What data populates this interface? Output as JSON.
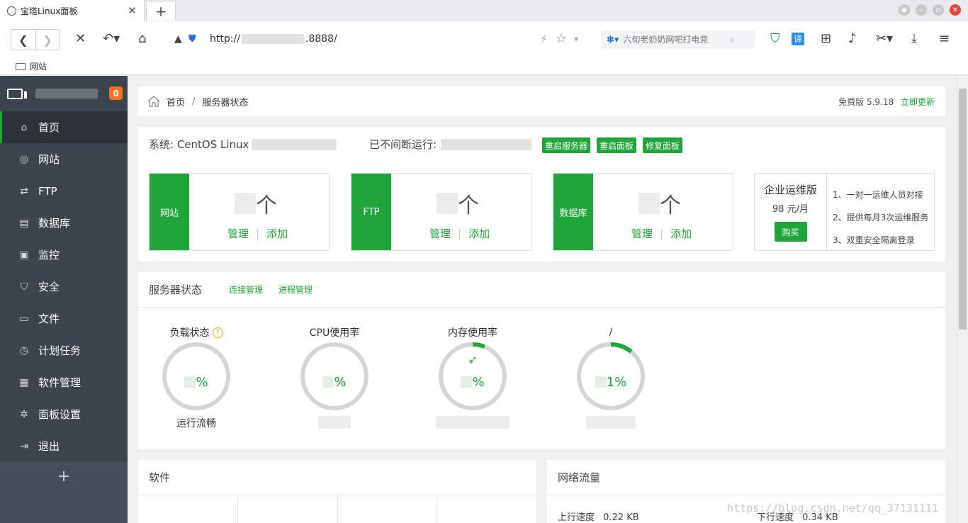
{
  "browser": {
    "tab_title": "宝塔Linux面板",
    "tab_close": "✕",
    "new_tab": "+",
    "url_prefix": "http://",
    "url_suffix": ".8888/",
    "search_placeholder": "六旬老奶奶网吧打电竞",
    "translate_label": "译",
    "bookmark_folder": "网站"
  },
  "sidebar": {
    "badge": "0",
    "items": [
      {
        "label": "首页",
        "icon": "home-icon",
        "glyph": "⌂"
      },
      {
        "label": "网站",
        "icon": "globe-icon",
        "glyph": "◎"
      },
      {
        "label": "FTP",
        "icon": "ftp-icon",
        "glyph": "⇄"
      },
      {
        "label": "数据库",
        "icon": "database-icon",
        "glyph": "▤"
      },
      {
        "label": "监控",
        "icon": "monitor-chart-icon",
        "glyph": "▣"
      },
      {
        "label": "安全",
        "icon": "shield-icon",
        "glyph": "⛉"
      },
      {
        "label": "文件",
        "icon": "folder-icon",
        "glyph": "▭"
      },
      {
        "label": "计划任务",
        "icon": "clock-icon",
        "glyph": "◷"
      },
      {
        "label": "软件管理",
        "icon": "grid-icon",
        "glyph": "▦"
      },
      {
        "label": "面板设置",
        "icon": "gear-icon",
        "glyph": "✲"
      },
      {
        "label": "退出",
        "icon": "logout-icon",
        "glyph": "⇥"
      }
    ],
    "add_label": "+"
  },
  "breadcrumb": {
    "home": "首页",
    "separator": "/",
    "current": "服务器状态",
    "version": "免费版 5.9.18",
    "update": "立即更新"
  },
  "system": {
    "os_label": "系统: CentOS Linux",
    "uptime_label": "已不间断运行:",
    "restart_server": "重启服务器",
    "restart_panel": "重启面板",
    "repair_panel": "修复面板"
  },
  "stats": [
    {
      "label": "网站",
      "unit": "个",
      "manage": "管理",
      "sep": "|",
      "add": "添加"
    },
    {
      "label": "FTP",
      "unit": "个",
      "manage": "管理",
      "sep": "|",
      "add": "添加"
    },
    {
      "label": "数据库",
      "unit": "个",
      "manage": "管理",
      "sep": "|",
      "add": "添加"
    }
  ],
  "enterprise": {
    "title": "企业运维版",
    "price": "98 元/月",
    "buy": "购买",
    "features": [
      "1、一对一运维人员对接",
      "2、提供每月3次运维服务",
      "3、双重安全隔离登录"
    ]
  },
  "server_status": {
    "title": "服务器状态",
    "links": [
      "连接管理",
      "进程管理"
    ],
    "gauges": [
      {
        "title": "负载状态",
        "pct": "%",
        "sub": "运行流畅",
        "fraction": 0.0
      },
      {
        "title": "CPU使用率",
        "pct": "%",
        "sub": "",
        "fraction": 0.0
      },
      {
        "title": "内存使用率",
        "pct": "%",
        "sub": "",
        "fraction": 0.06
      },
      {
        "title": "/",
        "pct": "1%",
        "sub": "",
        "fraction": 0.11
      }
    ]
  },
  "software": {
    "title": "软件"
  },
  "network": {
    "title": "网络流量",
    "up_label": "上行速度",
    "up_value": "0.22 KB",
    "down_label": "下行速度",
    "down_value": "0.34 KB"
  },
  "watermark": "https://blog.csdn.net/qq_37131111",
  "colors": {
    "accent": "#20a53a",
    "sidebar": "#3c444d",
    "badge": "#f7701b"
  }
}
